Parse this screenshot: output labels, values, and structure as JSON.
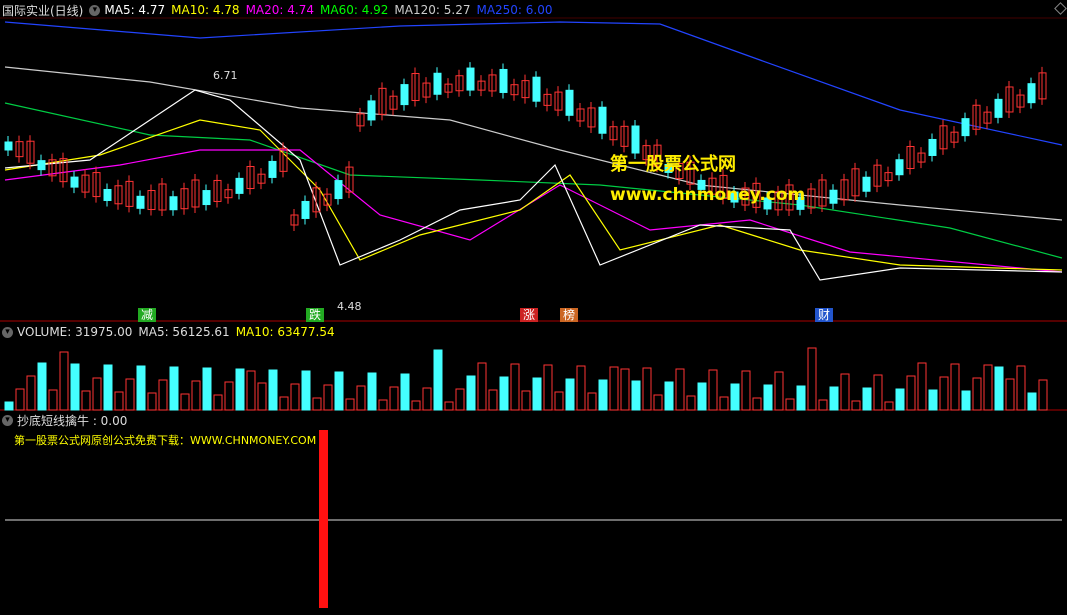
{
  "main_panel": {
    "title": "国际实业(日线)",
    "ma_labels": [
      {
        "text": "MA5: 4.77",
        "color": "#ffffff"
      },
      {
        "text": "MA10: 4.78",
        "color": "#ffff00"
      },
      {
        "text": "MA20: 4.74",
        "color": "#ff00ff"
      },
      {
        "text": "MA60: 4.92",
        "color": "#00ff00"
      },
      {
        "text": "MA120: 5.27",
        "color": "#cccccc"
      },
      {
        "text": "MA250: 6.00",
        "color": "#2244ff"
      }
    ],
    "high_label": "6.71",
    "low_label": "4.48",
    "tags": [
      {
        "text": "减",
        "color": "#22aa22"
      },
      {
        "text": "跌",
        "color": "#22aa22"
      },
      {
        "text": "涨",
        "color": "#cc2222"
      },
      {
        "text": "榜",
        "color": "#cc6622"
      },
      {
        "text": "财",
        "color": "#2255cc"
      }
    ]
  },
  "watermark": {
    "line1": "第一股票公式网",
    "line2": "www.chnmoney.com"
  },
  "volume_panel": {
    "title": "VOLUME: 31975.00",
    "ma5": "MA5: 56125.61",
    "ma10": "MA10: 63477.54"
  },
  "indicator_panel": {
    "title": "抄底短线擒牛 : 0.00",
    "note": "第一股票公式网原创公式免费下载：WWW.CHNMONEY.COM"
  }
}
